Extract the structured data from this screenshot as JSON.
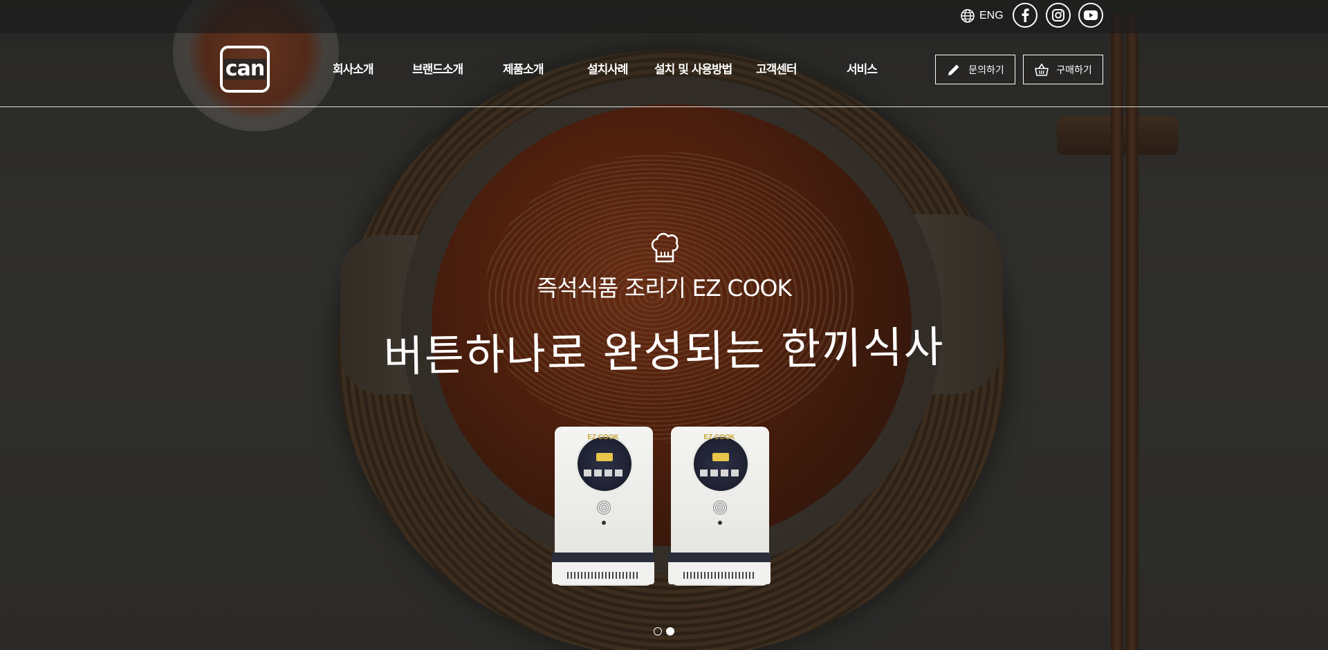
{
  "topbar": {
    "lang_label": "ENG",
    "social": [
      {
        "name": "facebook",
        "icon": "facebook-icon"
      },
      {
        "name": "instagram",
        "icon": "instagram-icon"
      },
      {
        "name": "youtube",
        "icon": "youtube-icon"
      }
    ]
  },
  "header": {
    "logo_text": "can",
    "nav": [
      {
        "label": "회사소개"
      },
      {
        "label": "브랜드소개"
      },
      {
        "label": "제품소개"
      },
      {
        "label": "설치사례"
      },
      {
        "label": "설치 및 사용방법"
      },
      {
        "label": "고객센터"
      },
      {
        "label": "서비스"
      }
    ],
    "buttons": {
      "inquiry_label": "문의하기",
      "buy_label": "구매하기"
    }
  },
  "hero": {
    "subtitle": "즉석식품 조리기 EZ COOK",
    "headline": "버튼하나로 완성되는 한끼식사",
    "product_brand": "EZ COOK",
    "slider": {
      "total": 2,
      "active": 2
    }
  },
  "colors": {
    "accent_gold": "#c9a73a",
    "topbar_bg": "#1c1c1c",
    "text": "#ffffff"
  }
}
